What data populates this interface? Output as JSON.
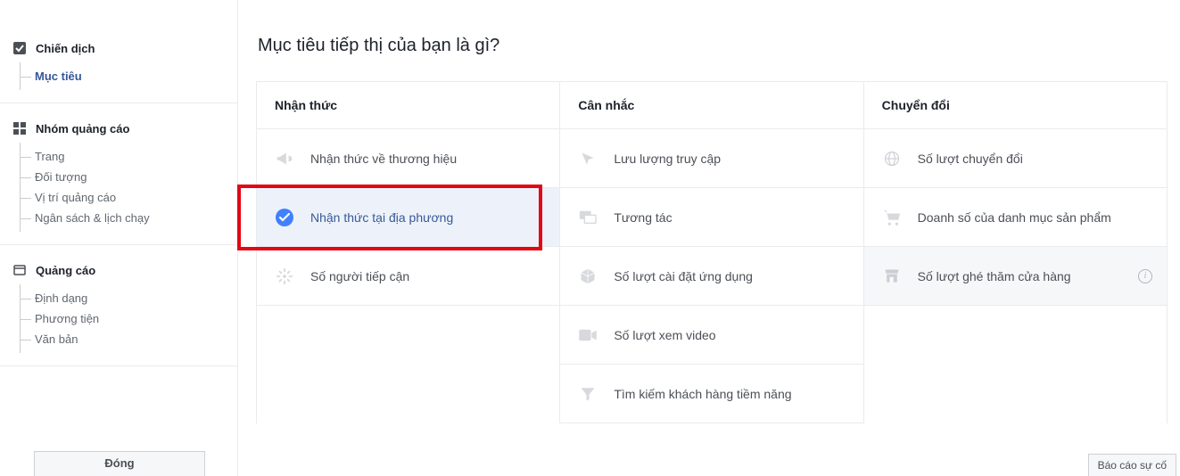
{
  "sidebar": {
    "sections": [
      {
        "title": "Chiến dịch",
        "active_child": 0,
        "items": [
          "Mục tiêu"
        ]
      },
      {
        "title": "Nhóm quảng cáo",
        "items": [
          "Trang",
          "Đối tượng",
          "Vị trí quảng cáo",
          "Ngân sách & lịch chạy"
        ]
      },
      {
        "title": "Quảng cáo",
        "items": [
          "Định dạng",
          "Phương tiện",
          "Văn bản"
        ]
      }
    ],
    "close_label": "Đóng"
  },
  "main": {
    "title": "Mục tiêu tiếp thị của bạn là gì?",
    "columns": [
      {
        "heading": "Nhận thức",
        "options": [
          {
            "label": "Nhận thức về thương hiệu",
            "icon": "megaphone",
            "selected": false
          },
          {
            "label": "Nhận thức tại địa phương",
            "icon": "check-circle",
            "selected": true
          },
          {
            "label": "Số người tiếp cận",
            "icon": "reach",
            "selected": false
          }
        ]
      },
      {
        "heading": "Cân nhắc",
        "options": [
          {
            "label": "Lưu lượng truy cập",
            "icon": "cursor",
            "selected": false
          },
          {
            "label": "Tương tác",
            "icon": "chat",
            "selected": false
          },
          {
            "label": "Số lượt cài đặt ứng dụng",
            "icon": "box",
            "selected": false
          },
          {
            "label": "Số lượt xem video",
            "icon": "video",
            "selected": false
          },
          {
            "label": "Tìm kiếm khách hàng tiềm năng",
            "icon": "funnel",
            "selected": false
          }
        ]
      },
      {
        "heading": "Chuyển đổi",
        "options": [
          {
            "label": "Số lượt chuyển đổi",
            "icon": "globe",
            "selected": false
          },
          {
            "label": "Doanh số của danh mục sản phẩm",
            "icon": "cart",
            "selected": false
          },
          {
            "label": "Số lượt ghé thăm cửa hàng",
            "icon": "store",
            "selected": false,
            "hover": true,
            "info": true
          }
        ]
      }
    ]
  },
  "footer": {
    "report_label": "Báo cáo sự cố"
  }
}
